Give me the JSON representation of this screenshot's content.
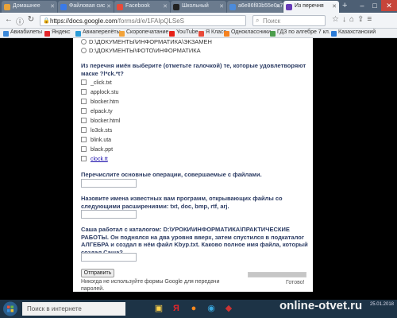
{
  "browser": {
    "tabs": [
      {
        "label": "Домашнее",
        "color": "#e8a33a"
      },
      {
        "label": "Файловая сис",
        "color": "#3a7ae8"
      },
      {
        "label": "Facebook",
        "color": "#e84a3a"
      },
      {
        "label": "Школьный",
        "color": "#222222"
      },
      {
        "label": "a6e86f83b55e0a7",
        "color": "#4c8bdb"
      },
      {
        "label": "Из перечня",
        "color": "#673ab7"
      }
    ],
    "url_host": "https://docs.google.com",
    "url_path": "/forms/d/e/1FAIpQLSeS",
    "search_placeholder": "Поиск",
    "bookmarks": [
      {
        "label": "Авиабилеты",
        "color": "#3a87d8"
      },
      {
        "label": "Яндекс",
        "color": "#e3262b"
      },
      {
        "label": "Авиаперелёты",
        "color": "#2a9bd6"
      },
      {
        "label": "Скоропечатание",
        "color": "#f2a33a"
      },
      {
        "label": "YouTube",
        "color": "#e62117"
      },
      {
        "label": "Я Класс",
        "color": "#e84a3a"
      },
      {
        "label": "Одноклассники",
        "color": "#f58220"
      },
      {
        "label": "ГДЗ по алгебре 7 кл.",
        "color": "#4c9d4c"
      },
      {
        "label": "Казахстанский",
        "color": "#2a7ad6"
      }
    ]
  },
  "form": {
    "options": [
      "D:\\ДОКУМЕНТЫ\\ИНФОРМАТИКА\\ЭКЗАМЕН",
      "D:\\ДОКУМЕНТЫ\\ФОТО\\ИНФОРМАТИКА"
    ],
    "q1_title": "Из перечня имён выберите (отметьте галочкой) те, которые удовлетворяют маске ?l*ck.*t?",
    "q1_options": [
      "_click.txt",
      "applock.stu",
      "blocker.htm",
      "elpack.ty",
      "blocker.html",
      "lo3ck.sts",
      "blink.uta",
      "black.ppt",
      "clock.tt"
    ],
    "q2_title": "Перечислите основные операции, совершаемые с файлами.",
    "q3_title": "Назовите имена известных вам программ, открывающих файлы со следующими расширениями: txt, doc, bmp, rtf, arj.",
    "q4_title": "Саша работал с каталогом: D:\\УРОКИ\\ИНФОРМАТИКА\\ПРАКТИЧЕСКИЕ РАБОТЫ. Он поднялся на два уровня вверх, затем спустился в подкаталог АЛГЕБРА и создал в нём файл Kbyp.txt. Каково полное имя файла, который создал Саша?",
    "submit_label": "Отправить",
    "note": "Никогда не используйте формы Google для передачи паролей.",
    "progress_label": "Готово!",
    "progress": 1.0
  },
  "taskbar": {
    "search_placeholder": "Поиск в интернете",
    "date": "25.01.2018"
  },
  "watermark": "online-otvet.ru"
}
